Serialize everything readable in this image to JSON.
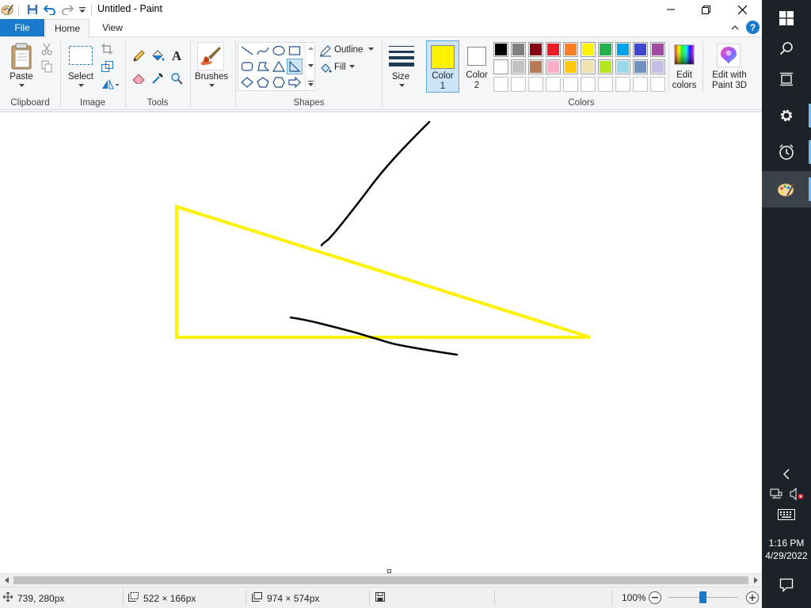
{
  "window": {
    "title": "Untitled - Paint"
  },
  "tabs": {
    "file": "File",
    "home": "Home",
    "view": "View"
  },
  "ribbon": {
    "clipboard": {
      "paste": "Paste",
      "group": "Clipboard"
    },
    "image": {
      "select": "Select",
      "group": "Image"
    },
    "tools": {
      "group": "Tools"
    },
    "brushes": {
      "label": "Brushes"
    },
    "shapes": {
      "outline": "Outline",
      "fill": "Fill",
      "group": "Shapes"
    },
    "size": {
      "label": "Size"
    },
    "colors": {
      "color1_label": "Color",
      "color1_num": "1",
      "color2_label": "Color",
      "color2_num": "2",
      "edit_colors_line1": "Edit",
      "edit_colors_line2": "colors",
      "paint3d_line1": "Edit with",
      "paint3d_line2": "Paint 3D",
      "group": "Colors",
      "color1_value": "#fff200",
      "color2_value": "#ffffff",
      "palette_row1": [
        "#000000",
        "#7f7f7f",
        "#880015",
        "#ed1c24",
        "#ff7f27",
        "#fff200",
        "#22b14c",
        "#00a2e8",
        "#3f48cc",
        "#a349a4"
      ],
      "palette_row2": [
        "#ffffff",
        "#c3c3c3",
        "#b97a57",
        "#ffaec9",
        "#ffc90e",
        "#efe4b0",
        "#b5e61d",
        "#99d9ea",
        "#7092be",
        "#c8bfe7"
      ],
      "palette_row3": [
        "#ffffff",
        "#ffffff",
        "#ffffff",
        "#ffffff",
        "#ffffff",
        "#ffffff",
        "#ffffff",
        "#ffffff",
        "#ffffff",
        "#ffffff"
      ]
    }
  },
  "status": {
    "cursor_pos": "739, 280px",
    "selection_size": "522 × 166px",
    "canvas_size": "974 × 574px",
    "zoom": "100%"
  },
  "taskbar": {
    "time": "1:16 PM",
    "date": "4/29/2022"
  },
  "colors": {
    "accent_blue": "#1979ca",
    "triangle_yellow": "#fff200",
    "stroke_black": "#000000",
    "taskbar_bg": "#1c2228"
  }
}
